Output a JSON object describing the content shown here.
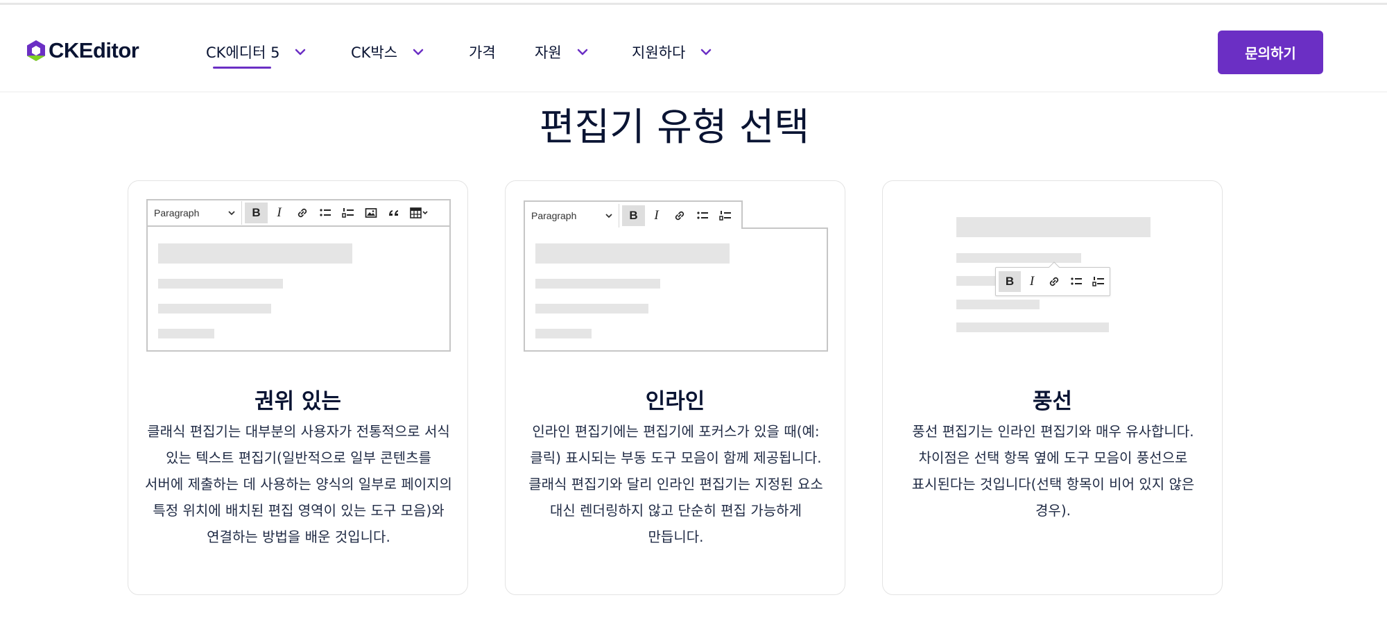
{
  "header": {
    "logo_text": "CKEditor",
    "nav": [
      {
        "label": "CK에디터 5",
        "has_dropdown": true,
        "active": true
      },
      {
        "label": "CK박스",
        "has_dropdown": true,
        "active": false
      },
      {
        "label": "가격",
        "has_dropdown": false,
        "active": false
      },
      {
        "label": "자원",
        "has_dropdown": true,
        "active": false
      },
      {
        "label": "지원하다",
        "has_dropdown": true,
        "active": false
      }
    ],
    "cta_label": "문의하기"
  },
  "section": {
    "title": "편집기 유형 선택"
  },
  "toolbar": {
    "paragraph_select": "Paragraph",
    "bold": "B",
    "italic": "I"
  },
  "cards": [
    {
      "title": "권위 있는",
      "description": "클래식 편집기는 대부분의 사용자가 전통적으로 서식 있는 텍스트 편집기(일반적으로 일부 콘텐츠를 서버에 제출하는 데 사용하는 양식의 일부로 페이지의 특정 위치에 배치된 편집 영역이 있는 도구 모음)와 연결하는 방법을 배운 것입니다."
    },
    {
      "title": "인라인",
      "description": "인라인 편집기에는 편집기에 포커스가 있을 때(예: 클릭) 표시되는 부동 도구 모음이 함께 제공됩니다. 클래식 편집기와 달리 인라인 편집기는 지정된 요소 대신 렌더링하지 않고 단순히 편집 가능하게 만듭니다."
    },
    {
      "title": "풍선",
      "description": "풍선 편집기는 인라인 편집기와 매우 유사합니다. 차이점은 선택 항목 옆에 도구 모음이 풍선으로 표시된다는 것입니다(선택 항목이 비어 있지 않은 경우)."
    }
  ],
  "colors": {
    "accent": "#6b2fc4",
    "logo_green": "#7ed321",
    "text": "#0a1433",
    "placeholder": "#e5e5e5"
  },
  "icons": [
    "chevron-down-icon",
    "link-icon",
    "bulleted-list-icon",
    "numbered-list-icon",
    "image-icon",
    "quote-icon",
    "table-icon"
  ]
}
